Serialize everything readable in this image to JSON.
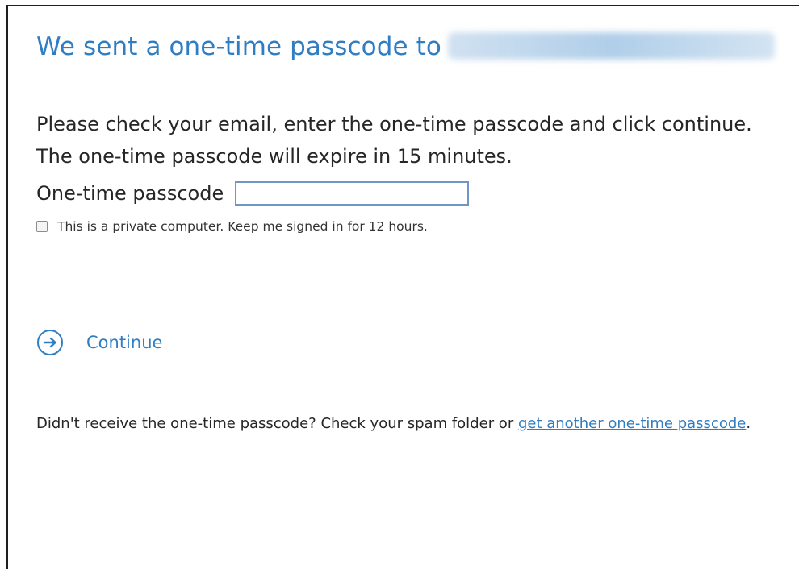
{
  "heading": {
    "prefix": "We sent a one-time passcode to"
  },
  "instructions": {
    "line1": "Please check your email, enter the one-time passcode and click continue.",
    "line2": "The one-time passcode will expire in 15 minutes."
  },
  "otp": {
    "label": "One-time passcode",
    "value": "",
    "placeholder": ""
  },
  "remember": {
    "label": "This is a private computer. Keep me signed in for 12 hours.",
    "checked": false
  },
  "continue": {
    "label": "Continue",
    "icon": "arrow-right-circle-icon"
  },
  "resend": {
    "prefix": "Didn't receive the one-time passcode? Check your spam folder or ",
    "link_text": "get another one-time passcode",
    "suffix": "."
  },
  "colors": {
    "accent": "#2f7dc2",
    "text": "#262626",
    "input_border": "#6f95c9",
    "frame": "#1f1f1f"
  }
}
